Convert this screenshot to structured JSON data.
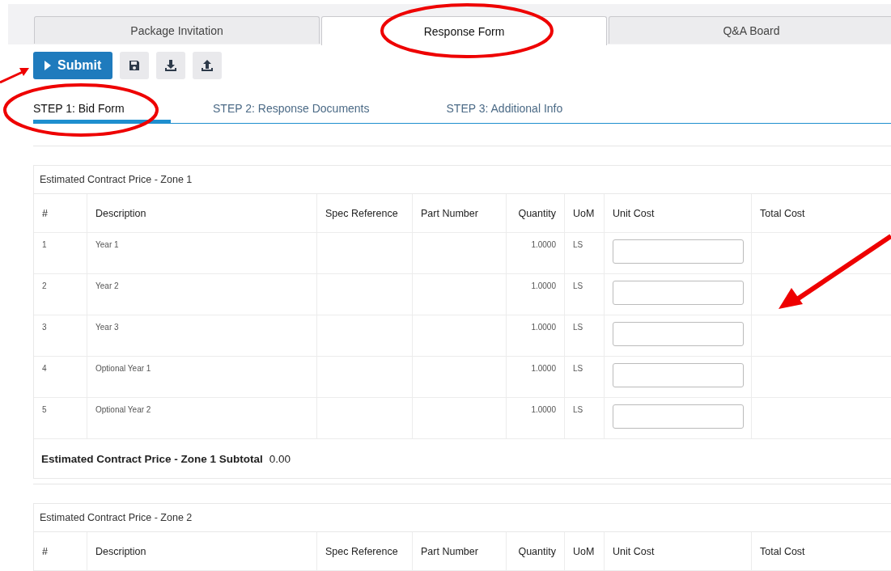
{
  "tabs": [
    {
      "label": "Package Invitation",
      "selected": false
    },
    {
      "label": "Response Form",
      "selected": true
    },
    {
      "label": "Q&A Board",
      "selected": false
    }
  ],
  "toolbar": {
    "submit_label": "Submit"
  },
  "steps": [
    {
      "label": "STEP 1: Bid Form",
      "selected": true
    },
    {
      "label": "STEP 2: Response Documents",
      "selected": false
    },
    {
      "label": "STEP 3: Additional Info",
      "selected": false
    }
  ],
  "sections": [
    {
      "title": "Estimated Contract Price - Zone 1",
      "columns": [
        "#",
        "Description",
        "Spec Reference",
        "Part Number",
        "Quantity",
        "UoM",
        "Unit Cost",
        "Total Cost"
      ],
      "rows": [
        {
          "number": "1",
          "description": "Year 1",
          "quantity": "1.0000",
          "uom": "LS"
        },
        {
          "number": "2",
          "description": "Year 2",
          "quantity": "1.0000",
          "uom": "LS"
        },
        {
          "number": "3",
          "description": "Year 3",
          "quantity": "1.0000",
          "uom": "LS"
        },
        {
          "number": "4",
          "description": "Optional Year 1",
          "quantity": "1.0000",
          "uom": "LS"
        },
        {
          "number": "5",
          "description": "Optional Year 2",
          "quantity": "1.0000",
          "uom": "LS"
        }
      ],
      "subtotal": {
        "label": "Estimated Contract Price - Zone 1 Subtotal",
        "value": "0.00"
      }
    },
    {
      "title": "Estimated Contract Price - Zone 2",
      "columns": [
        "#",
        "Description",
        "Spec Reference",
        "Part Number",
        "Quantity",
        "UoM",
        "Unit Cost",
        "Total Cost"
      ]
    }
  ]
}
